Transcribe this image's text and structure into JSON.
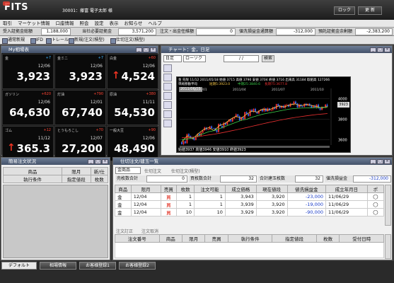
{
  "app": {
    "logo": "FITS",
    "user": "30001：藤富 電子太郎 様",
    "btn_lock": "ロック",
    "btn_refresh": "更 新"
  },
  "menu": [
    "取引",
    "マーケット情報",
    "口座情報",
    "照会",
    "設定",
    "表示",
    "お知らせ",
    "ヘルプ"
  ],
  "info": [
    {
      "label": "受入証拠金総額",
      "value": "1,188,000"
    },
    {
      "label": "当社必要証拠金",
      "value": "3,571,200"
    },
    {
      "label": "注文・出金任維額",
      "value": "0"
    },
    {
      "label": "値洗損益金通算額",
      "value": "-312,000"
    },
    {
      "label": "預託証拠金余剰額",
      "value": "-2,383,200"
    }
  ],
  "toolbar": [
    "通常新規",
    "IFD",
    "トレール",
    "新規/注文(積型)",
    "仕切注文(積型)"
  ],
  "quote_panel": {
    "title": "My相場表"
  },
  "tiles": [
    {
      "name": "金",
      "change": "+7",
      "date": "12/06",
      "price": "3,923",
      "chg_color": "#3fb4ff",
      "arrow": ""
    },
    {
      "name": "金ミニ",
      "change": "+7",
      "date": "12/06",
      "price": "3,923",
      "chg_color": "#3fb4ff",
      "arrow": ""
    },
    {
      "name": "白金",
      "change": "+60",
      "date": "12/06",
      "price": "4,524",
      "chg_color": "#ff4433",
      "arrow": "↑"
    },
    {
      "name": "ガソリン",
      "change": "+620",
      "date": "12/06",
      "price": "64,630",
      "chg_color": "#ff4433",
      "arrow": ""
    },
    {
      "name": "灯油",
      "change": "+790",
      "date": "12/01",
      "price": "67,740",
      "chg_color": "#ff4433",
      "arrow": ""
    },
    {
      "name": "原油",
      "change": "+380",
      "date": "11/11",
      "price": "54,530",
      "chg_color": "#ff4433",
      "arrow": ""
    },
    {
      "name": "ゴム",
      "change": "+12",
      "date": "11/12",
      "price": "365.3",
      "chg_color": "#ff4433",
      "arrow": "↑"
    },
    {
      "name": "とうもろこし",
      "change": "+70",
      "date": "12/07",
      "price": "27,200",
      "chg_color": "#ff4433",
      "arrow": ""
    },
    {
      "name": "一般大豆",
      "change": "+90",
      "date": "12/06",
      "price": "48,490",
      "chg_color": "#ff4433",
      "arrow": ""
    }
  ],
  "chart_panel": {
    "title": "チャート：金，日足",
    "period": "日足",
    "type": "ローソク",
    "date_sep": "/    /",
    "search": "検索",
    "header_line1": "金 先限 11/12 2011/05/18 始値 3715 高値 3790 安値 3704 終値 3716 出来高 31184 取組高 127266",
    "header_line2": "単純移動平均",
    "ma_labels": [
      "短期5:3923.0",
      "中期25:3840.6",
      "長期75:3677.8"
    ],
    "date_tag": "2011/06/15",
    "footer": "始値3937  高値3946  安値3910  終値3923",
    "price_tag": "3923"
  },
  "chart_data": {
    "type": "line",
    "title": "",
    "x_labels": [
      "2011/01",
      "2011/04",
      "2011/07",
      "2011/10"
    ],
    "y_ticks": [
      "4000",
      "3800",
      "3600"
    ],
    "ylim": [
      3550,
      4100
    ],
    "last": 3923,
    "series": [
      {
        "name": "短期5",
        "values": [
          3580,
          3640,
          3610,
          3660,
          3700,
          3720,
          3690,
          3740,
          3760,
          3800,
          3830,
          3810,
          3850,
          3880,
          3870,
          3900,
          3890,
          3910,
          3930,
          3920,
          3940,
          3950,
          3930,
          3945,
          3935,
          3925,
          3910,
          3923
        ]
      },
      {
        "name": "中期25",
        "values": [
          3600,
          3610,
          3620,
          3640,
          3660,
          3680,
          3690,
          3710,
          3730,
          3750,
          3770,
          3790,
          3800,
          3820,
          3835,
          3850,
          3860,
          3870,
          3880,
          3890,
          3900,
          3905,
          3908,
          3910,
          3912,
          3913,
          3915,
          3918
        ]
      },
      {
        "name": "長期75",
        "values": [
          3620,
          3622,
          3626,
          3632,
          3640,
          3648,
          3656,
          3665,
          3675,
          3686,
          3697,
          3708,
          3720,
          3732,
          3744,
          3756,
          3768,
          3779,
          3790,
          3800,
          3810,
          3818,
          3826,
          3833,
          3840,
          3846,
          3851,
          3856
        ]
      }
    ]
  },
  "order_panel": {
    "title": "簡易注文状況",
    "cols_row1": [
      "商品",
      "限月",
      "新/仕"
    ],
    "cols_row2": [
      "執行条件",
      "指定値段",
      "枚数"
    ]
  },
  "pos_panel": {
    "title": "仕切注文/建玉一覧",
    "select": "金商品",
    "link1": "仕切注文",
    "link2": "仕切注文(積型)",
    "sum_labels": [
      "売枚数合計",
      "買枚数合計",
      "合計建玉枚数",
      "値洗損益金"
    ],
    "sum_values": [
      "0",
      "32",
      "32",
      "-312,000"
    ],
    "cols": [
      "商品",
      "限月",
      "売買",
      "枚数",
      "注文可能",
      "成立価格",
      "現在値段",
      "値洗損益金",
      "成立年月日",
      "ポ"
    ],
    "rows": [
      [
        "金",
        "12/04",
        "買",
        "1",
        "1",
        "3,943",
        "3,920",
        "-23,000",
        "11/06/29",
        "◯"
      ],
      [
        "金",
        "12/04",
        "買",
        "1",
        "1",
        "3,939",
        "3,920",
        "-19,000",
        "11/06/29",
        "◯"
      ],
      [
        "金",
        "12/04",
        "買",
        "10",
        "10",
        "3,929",
        "3,920",
        "-90,000",
        "11/06/29",
        "◯"
      ]
    ],
    "link3": "注文訂正",
    "link4": "注文取消",
    "cols2": [
      "注文番号",
      "商品",
      "限月",
      "売買",
      "執行条件",
      "指定値段",
      "枚数",
      "受付日時"
    ]
  },
  "tabs": [
    "デフォルト",
    "相場情報",
    "お客様登録1",
    "お客様登録2"
  ]
}
